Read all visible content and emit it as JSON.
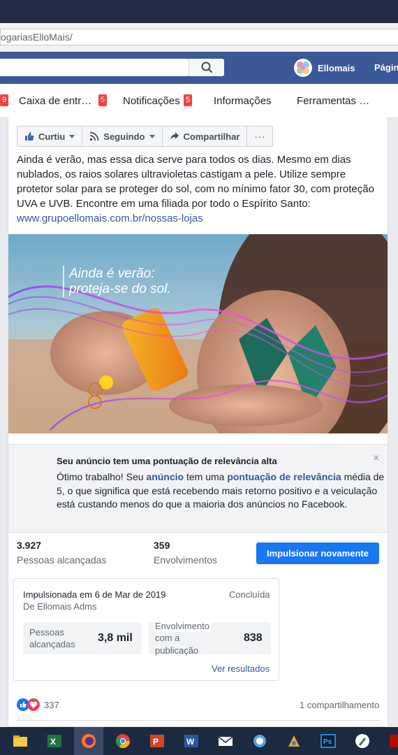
{
  "browser": {
    "url_text": "ogariasElloMais/"
  },
  "facebook_bar": {
    "search_placeholder": "",
    "profile_name": "Ellomais",
    "page_link": "Págin"
  },
  "subnav": {
    "items": [
      {
        "label": "Caixa de entr…",
        "badge": "5"
      },
      {
        "label": "Notificações",
        "badge": "5"
      },
      {
        "label": "Informações"
      },
      {
        "label": "Ferramentas …"
      }
    ],
    "left_badge": "9"
  },
  "post_actions": {
    "like": "Curtiu",
    "follow": "Seguindo",
    "share": "Compartilhar",
    "more": "···"
  },
  "post": {
    "text_line_1": "Ainda é verão, mas essa dica serve para todos os dias. Mesmo em dias nublados, os raios solares ultravioletas castigam a pele. Utilize sempre protetor solar para se proteger do sol, com no mínimo fator 30, com proteção UVA e UVB. Encontre em uma filiada por todo o Espírito Santo:",
    "link": "www.grupoellomais.com.br/nossas-lojas",
    "image_caption_1": "Ainda é verão:",
    "image_caption_2": "proteja-se do sol."
  },
  "relevance_notice": {
    "title": "Seu anúncio tem uma pontuação de relevância alta",
    "body_1": "Ótimo trabalho! Seu ",
    "link_1": "anúncio",
    "body_2": " tem uma ",
    "link_2": "pontuação de relevância",
    "body_3": " média de 5, o que significa que está recebendo mais retorno positivo e a veiculação está custando menos do que a maioria dos anúncios no Facebook.",
    "close": "×"
  },
  "stats": {
    "reach_value": "3.927",
    "reach_label": "Pessoas alcançadas",
    "engagement_value": "359",
    "engagement_label": "Envolvimentos",
    "boost_again": "Impulsionar novamente"
  },
  "boost_summary": {
    "boosted_on": "Impulsionada em 6 de Mar de 2019",
    "by": "De Ellomais Adms",
    "status": "Concluída",
    "metric_1_label_a": "Pessoas",
    "metric_1_label_b": "alcançadas",
    "metric_1_value": "3,8 mil",
    "metric_2_label_a": "Envolvimento",
    "metric_2_label_b": "com a",
    "metric_2_label_c": "publicação",
    "metric_2_value": "838",
    "see_results": "Ver resultados"
  },
  "footer": {
    "reaction_count": "337",
    "shares": "1 compartilhamento"
  },
  "colors": {
    "facebook_blue": "#3b5998",
    "button_blue": "#1877f2",
    "link_blue": "#365899",
    "badge_red": "#fa3e3e"
  }
}
